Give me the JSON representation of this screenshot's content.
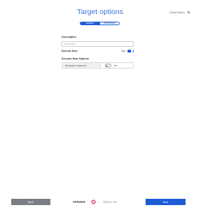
{
  "page": {
    "title": "Target options"
  },
  "header": {
    "global_options_label": "Global Options"
  },
  "tabs": [
    {
      "label": "BASICS",
      "active": true
    },
    {
      "label": "ADVANCED",
      "active": false
    }
  ],
  "form": {
    "description": {
      "label": "Description",
      "placeholder": "Description",
      "value": ""
    },
    "execute_now": {
      "label": "Execute Now",
      "value_label": "Yes",
      "enabled": true
    },
    "execute_now_options": {
      "label": "Execute Now Options",
      "rows": [
        {
          "name": "Shutdown Instances",
          "value_label": "No",
          "enabled": false
        }
      ]
    }
  },
  "footer": {
    "back_label": "Back",
    "next_label": "Next",
    "brand_left": "vmware",
    "brand_sep": "×",
    "brand_partner": "ORACLE VM"
  },
  "colors": {
    "accent": "#1e5bd6",
    "title": "#3a72d9",
    "back_button": "#7b7f85",
    "logo": "#e0457b"
  }
}
